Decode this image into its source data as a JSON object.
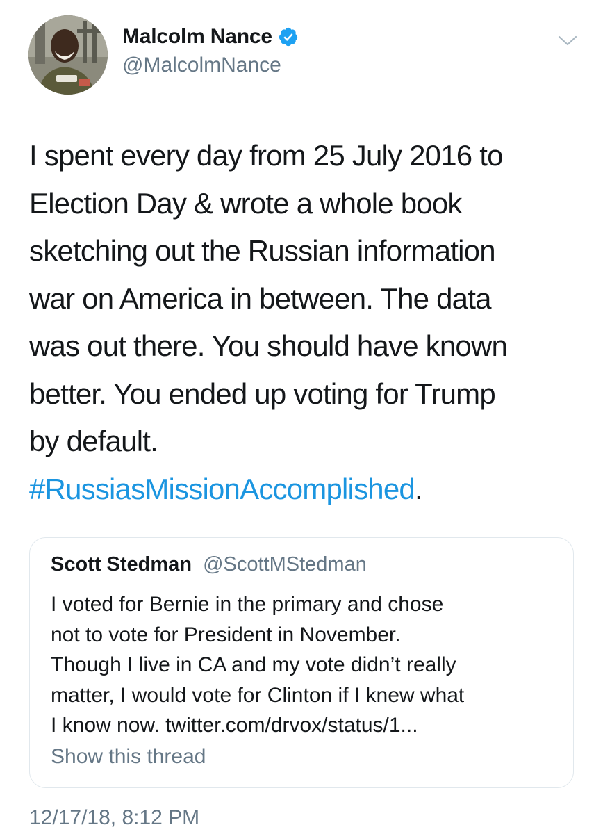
{
  "author": {
    "display_name": "Malcolm Nance",
    "handle": "@MalcolmNance",
    "verified": true,
    "avatar_icon": "profile-photo"
  },
  "tweet": {
    "text_lines": [
      "I spent every day from 25 July 2016 to",
      "Election Day & wrote a whole book",
      "sketching out the Russian information",
      "war on America in between. The data",
      "was out there. You should have known",
      "better. You ended up voting for Trump",
      "by default."
    ],
    "hashtag": "#RussiasMissionAccomplished",
    "hashtag_suffix": ".",
    "timestamp": "12/17/18, 8:12 PM"
  },
  "quoted_tweet": {
    "display_name": "Scott Stedman",
    "handle": "@ScottMStedman",
    "text": "I voted for Bernie in the primary and chose\nnot to vote for President in November.\nThough I live in CA and my vote didn’t really\nmatter, I would vote for Clinton if I knew what\nI know now. twitter.com/drvox/status/1...",
    "show_thread_label": "Show this thread"
  },
  "icons": {
    "verified": "verified-badge-icon",
    "menu": "chevron-down-icon"
  },
  "colors": {
    "link": "#1b95e0",
    "verified": "#1da1f2",
    "secondary_text": "#657786",
    "primary_text": "#14171a",
    "border": "#e1e8ed"
  }
}
